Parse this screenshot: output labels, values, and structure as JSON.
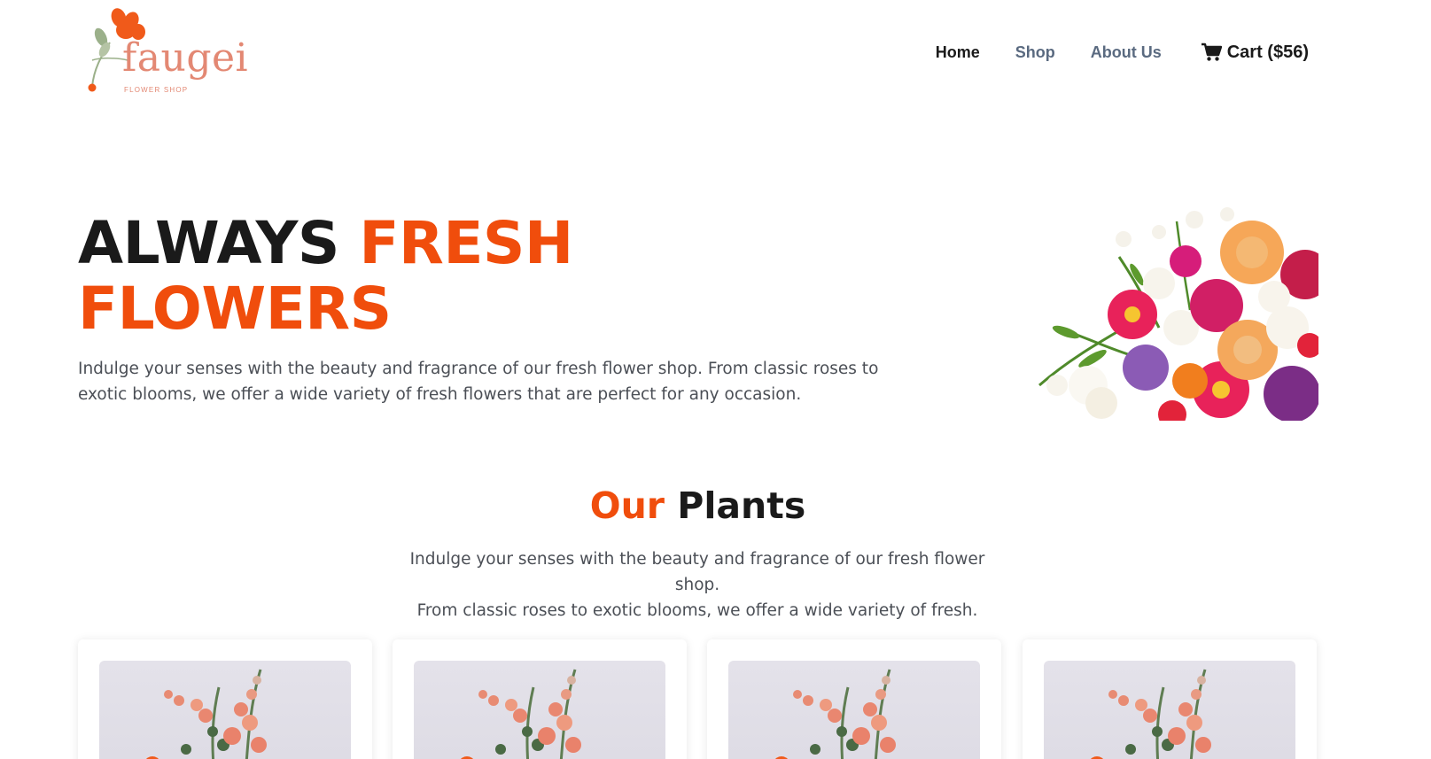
{
  "brand": {
    "name": "faugei",
    "tagline": "FLOWER SHOP",
    "color": "#e38873",
    "flower_color": "#f05a1a",
    "leaf_color": "#9bb08a"
  },
  "nav": {
    "items": [
      {
        "label": "Home",
        "active": true
      },
      {
        "label": "Shop",
        "active": false
      },
      {
        "label": "About Us",
        "active": false
      }
    ],
    "cart_label": "Cart ($56)",
    "cart_icon": "shopping-cart-icon"
  },
  "hero": {
    "title_dark": "ALWAYS ",
    "title_accent_1": "FRESH",
    "title_accent_2": "FLOWERS",
    "description": "Indulge your senses with the beauty and fragrance of our fresh flower shop. From classic roses to exotic blooms, we offer a wide variety of fresh flowers that are perfect for any occasion.",
    "image": "flower-bouquet-image"
  },
  "plants_section": {
    "title_accent": "Our",
    "title_dark": "Plants",
    "description_line1": "Indulge your senses with the beauty and fragrance of our fresh flower shop.",
    "description_line2": "From classic roses to exotic blooms, we offer a wide variety of fresh."
  },
  "products": [
    {
      "image": "snapdragon-bouquet-image"
    },
    {
      "image": "snapdragon-bouquet-image"
    },
    {
      "image": "snapdragon-bouquet-image"
    },
    {
      "image": "snapdragon-bouquet-image"
    }
  ],
  "colors": {
    "accent": "#f04d0c",
    "text_dark": "#1a1a1a",
    "text_muted": "#4b4f56",
    "nav_muted": "#5a6a80"
  }
}
